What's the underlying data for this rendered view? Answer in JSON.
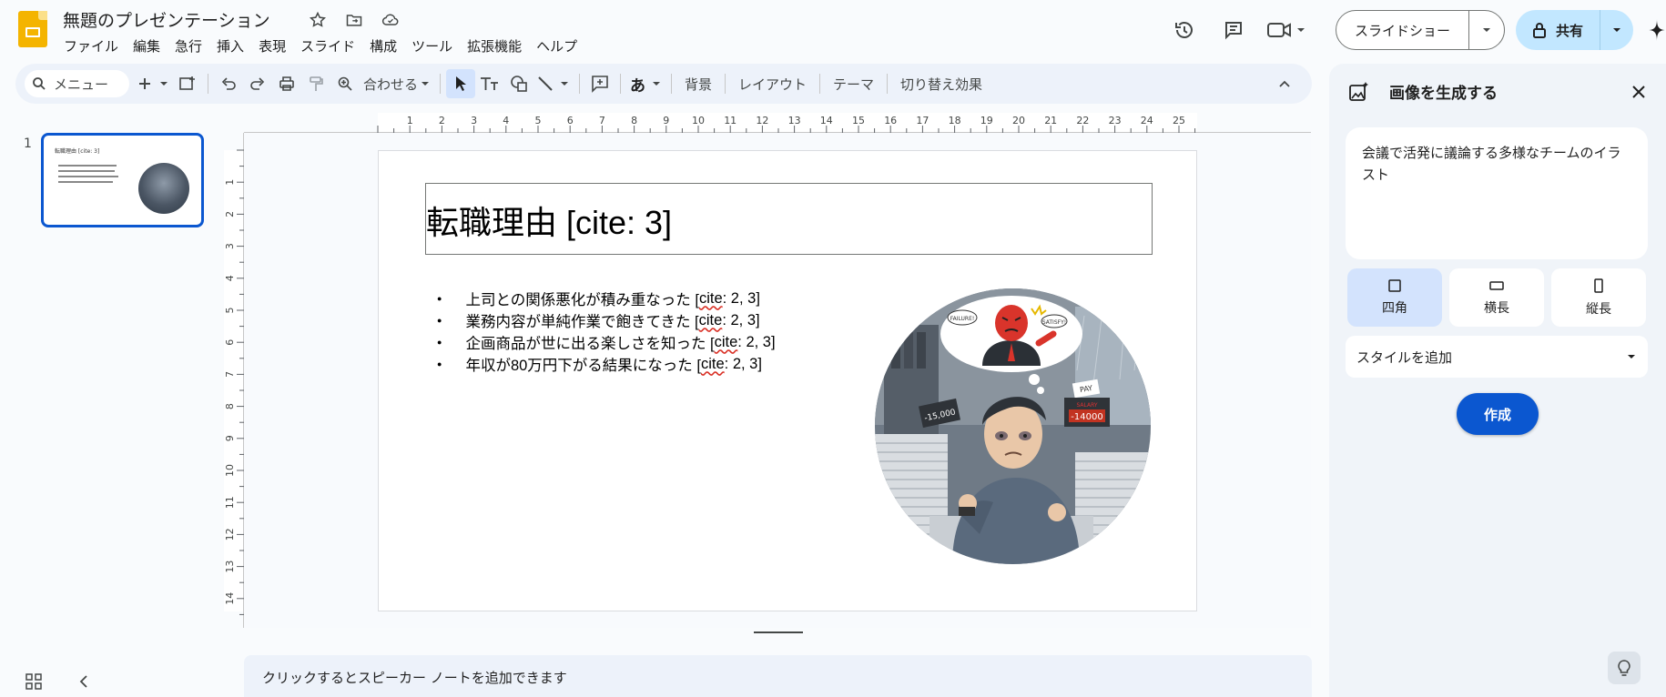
{
  "header": {
    "doc_title": "無題のプレゼンテーション",
    "menus": [
      "ファイル",
      "編集",
      "急行",
      "挿入",
      "表現",
      "スライド",
      "構成",
      "ツール",
      "拡張機能",
      "ヘルプ"
    ],
    "slideshow_label": "スライドショー",
    "share_label": "共有"
  },
  "toolbar": {
    "search_label": "メニュー",
    "zoom_label": "合わせる",
    "background_label": "背景",
    "layout_label": "レイアウト",
    "theme_label": "テーマ",
    "transition_label": "切り替え効果",
    "input_char": "あ"
  },
  "filmstrip": {
    "slide_number": "1",
    "thumb_title": "転職理由 [cite: 3]"
  },
  "ruler": {
    "top_ticks": [
      "1",
      "2",
      "3",
      "4",
      "5",
      "6",
      "7",
      "8",
      "9",
      "10",
      "11",
      "12",
      "13",
      "14",
      "15",
      "16",
      "17",
      "18",
      "19",
      "20",
      "21",
      "22",
      "23",
      "24",
      "25"
    ],
    "left_ticks": [
      "1",
      "2",
      "3",
      "4",
      "5",
      "6",
      "7",
      "8",
      "9",
      "10",
      "11",
      "12",
      "13",
      "14"
    ]
  },
  "slide": {
    "title": "転職理由 [cite: 3]",
    "bullets": [
      {
        "text": "上司との関係悪化が積み重なった [",
        "cite": "cite",
        "tail": ": 2, 3]"
      },
      {
        "text": "業務内容が単純作業で飽きてきた [",
        "cite": "cite",
        "tail": ": 2, 3]"
      },
      {
        "text": "企画商品が世に出る楽しさを知った [",
        "cite": "cite",
        "tail": ": 2, 3]"
      },
      {
        "text": "年収が80万円下がる結果になった [",
        "cite": "cite",
        "tail": ": 2, 3]"
      }
    ],
    "illustration": {
      "bubble_left": "FAILURE!",
      "bubble_right": "SATISFY!",
      "sign_left": "-15,000",
      "sign_right_top": "PAY",
      "sign_right_label": "SALARY",
      "sign_right_value": "-14000"
    }
  },
  "notes": {
    "placeholder": "クリックするとスピーカー ノートを追加できます"
  },
  "panel": {
    "title": "画像を生成する",
    "prompt": "会議で活発に議論する多様なチームのイラスト",
    "shapes": [
      {
        "label": "四角",
        "icon": "square-icon",
        "selected": true
      },
      {
        "label": "横長",
        "icon": "landscape-icon",
        "selected": false
      },
      {
        "label": "縦長",
        "icon": "portrait-icon",
        "selected": false
      }
    ],
    "style_placeholder": "スタイルを追加",
    "create_label": "作成"
  },
  "colors": {
    "accent": "#0b57d0",
    "share_bg": "#c2e7ff",
    "logo": "#f4b400"
  }
}
